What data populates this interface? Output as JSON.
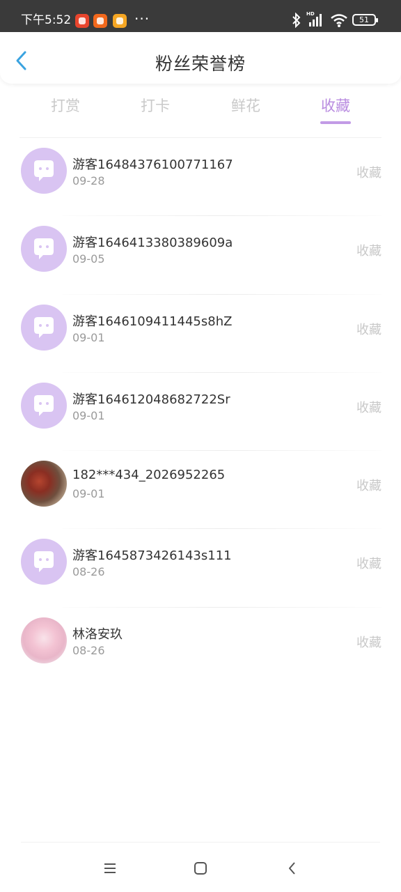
{
  "status_bar": {
    "time": "下午5:52",
    "more": "···",
    "battery": "51",
    "hd": "HD"
  },
  "header": {
    "title": "粉丝荣誉榜"
  },
  "tabs": [
    {
      "label": "打赏"
    },
    {
      "label": "打卡"
    },
    {
      "label": "鲜花"
    },
    {
      "label": "收藏"
    }
  ],
  "active_tab": "收藏",
  "colors": {
    "accent": "#b98ce0",
    "avatar_default": "#d9c4f2",
    "back_arrow": "#3aa3e0",
    "inactive_text": "#c9c9c9"
  },
  "fans": [
    {
      "name": "游客16484376100771167",
      "date": "09-28",
      "action": "收藏",
      "avatar": "default-chat-avatar"
    },
    {
      "name": "游客1646413380389609a",
      "date": "09-05",
      "action": "收藏",
      "avatar": "default-chat-avatar"
    },
    {
      "name": "游客1646109411445s8hZ",
      "date": "09-01",
      "action": "收藏",
      "avatar": "default-chat-avatar"
    },
    {
      "name": "游客164612048682722Sr",
      "date": "09-01",
      "action": "收藏",
      "avatar": "default-chat-avatar"
    },
    {
      "name": "182***434_2026952265",
      "date": "09-01",
      "action": "收藏",
      "avatar": "photo"
    },
    {
      "name": "游客1645873426143s111",
      "date": "08-26",
      "action": "收藏",
      "avatar": "default-chat-avatar"
    },
    {
      "name": "林洛安玖",
      "date": "08-26",
      "action": "收藏",
      "avatar": "photo"
    }
  ]
}
